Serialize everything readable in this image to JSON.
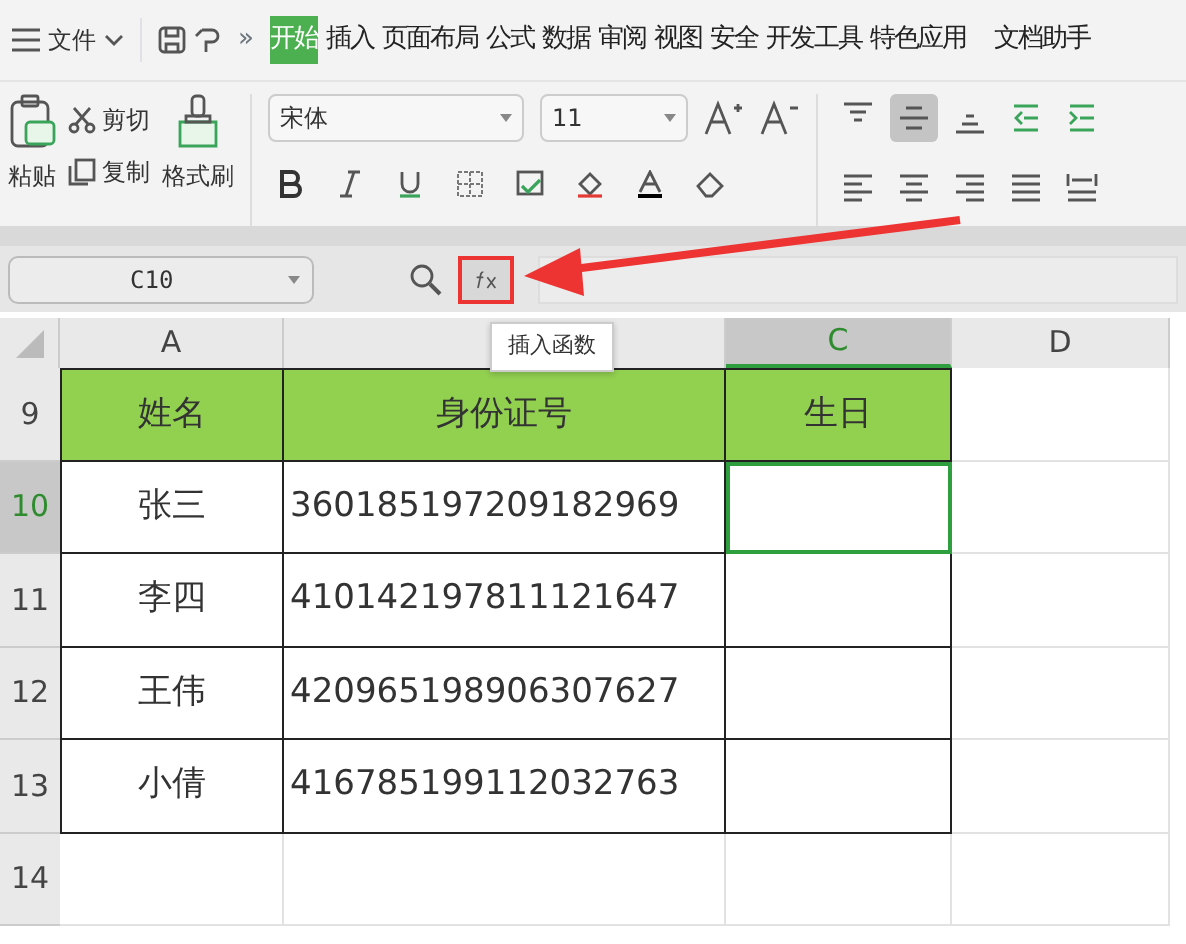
{
  "menu": {
    "file_label": "文件",
    "more": "»",
    "tabs": [
      {
        "label": "开始",
        "selected": true
      },
      {
        "label": "插入",
        "selected": false
      },
      {
        "label": "页面布局",
        "selected": false
      },
      {
        "label": "公式",
        "selected": false
      },
      {
        "label": "数据",
        "selected": false
      },
      {
        "label": "审阅",
        "selected": false
      },
      {
        "label": "视图",
        "selected": false
      },
      {
        "label": "安全",
        "selected": false
      },
      {
        "label": "开发工具",
        "selected": false
      },
      {
        "label": "特色应用",
        "selected": false
      },
      {
        "label": "文档助手",
        "selected": false
      }
    ]
  },
  "ribbon": {
    "paste": "粘贴",
    "cut": "剪切",
    "copy": "复制",
    "format_painter": "格式刷",
    "font": "宋体",
    "font_size": "11",
    "align_buttons": [
      {
        "kind": "top",
        "selected": false
      },
      {
        "kind": "middle",
        "selected": true
      },
      {
        "kind": "bottom",
        "selected": false
      },
      {
        "kind": "outdent",
        "selected": false
      },
      {
        "kind": "indent",
        "selected": false
      },
      {
        "kind": "left",
        "selected": false
      },
      {
        "kind": "center",
        "selected": false
      },
      {
        "kind": "right",
        "selected": false
      },
      {
        "kind": "justify",
        "selected": false
      },
      {
        "kind": "distribute",
        "selected": false
      }
    ]
  },
  "formula_bar": {
    "name_box": "C10",
    "tooltip": "插入函数"
  },
  "sheet": {
    "columns": [
      {
        "label": "A",
        "selected": false
      },
      {
        "selected": false
      },
      {
        "label": "C",
        "selected": true
      },
      {
        "label": "D",
        "selected": false
      }
    ],
    "rows": [
      {
        "number": "9",
        "header": true,
        "selected": false,
        "cells": [
          "姓名",
          "身份证号",
          "生日",
          ""
        ]
      },
      {
        "number": "10",
        "header": false,
        "selected": true,
        "cells": [
          "张三",
          "360185197209182969",
          "",
          ""
        ]
      },
      {
        "number": "11",
        "header": false,
        "selected": false,
        "cells": [
          "李四",
          "410142197811121647",
          "",
          ""
        ]
      },
      {
        "number": "12",
        "header": false,
        "selected": false,
        "cells": [
          "王伟",
          "420965198906307627",
          "",
          ""
        ]
      },
      {
        "number": "13",
        "header": false,
        "selected": false,
        "cells": [
          "小倩",
          "416785199112032763",
          "",
          ""
        ]
      },
      {
        "number": "14",
        "header": false,
        "selected": false,
        "cells": [
          "",
          "",
          "",
          ""
        ]
      }
    ]
  }
}
